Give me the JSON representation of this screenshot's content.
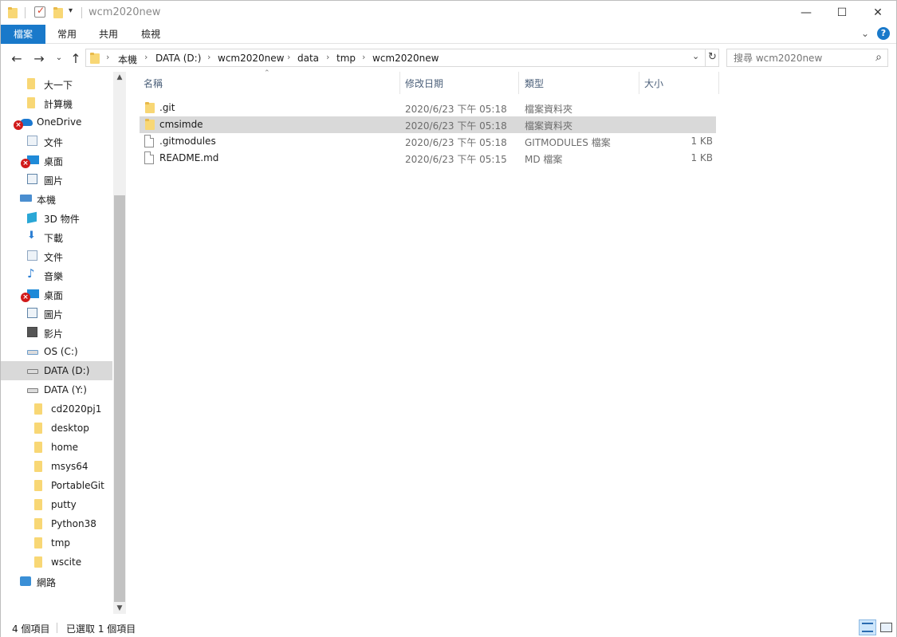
{
  "window": {
    "title": "wcm2020new",
    "controls": {
      "minimize": "—",
      "maximize": "☐",
      "close": "✕"
    }
  },
  "ribbon": {
    "tabs": [
      {
        "label": "檔案",
        "active": true
      },
      {
        "label": "常用"
      },
      {
        "label": "共用"
      },
      {
        "label": "檢視"
      }
    ],
    "help": "?"
  },
  "address": {
    "crumbs": [
      "本機",
      "DATA (D:)",
      "wcm2020new",
      "data",
      "tmp",
      "wcm2020new"
    ],
    "search_placeholder": "搜尋 wcm2020new"
  },
  "nav_pane": {
    "items": [
      {
        "label": "大一下",
        "icon": "folder-icon",
        "indent": 1
      },
      {
        "label": "計算機",
        "icon": "folder-icon",
        "indent": 1
      },
      {
        "label": "OneDrive",
        "icon": "onedrive-cloud-icon",
        "indent": 0,
        "error": true
      },
      {
        "label": "文件",
        "icon": "documents-icon",
        "indent": 1
      },
      {
        "label": "桌面",
        "icon": "desktop-icon",
        "indent": 1,
        "error": true
      },
      {
        "label": "圖片",
        "icon": "pictures-icon",
        "indent": 1
      },
      {
        "label": "本機",
        "icon": "this-pc-icon",
        "indent": 0
      },
      {
        "label": "3D 物件",
        "icon": "3d-objects-icon",
        "indent": 1
      },
      {
        "label": "下載",
        "icon": "downloads-icon",
        "indent": 1
      },
      {
        "label": "文件",
        "icon": "documents-icon",
        "indent": 1
      },
      {
        "label": "音樂",
        "icon": "music-icon",
        "indent": 1
      },
      {
        "label": "桌面",
        "icon": "desktop-icon",
        "indent": 1,
        "error": true
      },
      {
        "label": "圖片",
        "icon": "pictures-icon",
        "indent": 1
      },
      {
        "label": "影片",
        "icon": "videos-icon",
        "indent": 1
      },
      {
        "label": "OS (C:)",
        "icon": "os-drive-icon",
        "indent": 1
      },
      {
        "label": "DATA (D:)",
        "icon": "drive-icon",
        "indent": 1,
        "selected": true
      },
      {
        "label": "DATA (Y:)",
        "icon": "network-drive-icon",
        "indent": 1
      },
      {
        "label": "cd2020pj1",
        "icon": "folder-icon",
        "indent": 2
      },
      {
        "label": "desktop",
        "icon": "folder-icon",
        "indent": 2
      },
      {
        "label": "home",
        "icon": "folder-icon",
        "indent": 2
      },
      {
        "label": "msys64",
        "icon": "folder-icon",
        "indent": 2
      },
      {
        "label": "PortableGit",
        "icon": "folder-icon",
        "indent": 2
      },
      {
        "label": "putty",
        "icon": "folder-icon",
        "indent": 2
      },
      {
        "label": "Python38",
        "icon": "folder-icon",
        "indent": 2
      },
      {
        "label": "tmp",
        "icon": "folder-icon",
        "indent": 2
      },
      {
        "label": "wscite",
        "icon": "folder-icon",
        "indent": 2
      },
      {
        "label": "網路",
        "icon": "network-icon",
        "indent": 0
      }
    ]
  },
  "file_list": {
    "columns": [
      "名稱",
      "修改日期",
      "類型",
      "大小"
    ],
    "rows": [
      {
        "name": ".git",
        "date": "2020/6/23 下午 05:18",
        "type": "檔案資料夾",
        "size": "",
        "icon": "folder-icon"
      },
      {
        "name": "cmsimde",
        "date": "2020/6/23 下午 05:18",
        "type": "檔案資料夾",
        "size": "",
        "icon": "folder-icon",
        "selected": true
      },
      {
        "name": ".gitmodules",
        "date": "2020/6/23 下午 05:18",
        "type": "GITMODULES 檔案",
        "size": "1 KB",
        "icon": "file-icon"
      },
      {
        "name": "README.md",
        "date": "2020/6/23 下午 05:15",
        "type": "MD 檔案",
        "size": "1 KB",
        "icon": "file-icon"
      }
    ]
  },
  "status_bar": {
    "item_count": "4 個項目",
    "selected_count": "已選取 1 個項目"
  },
  "colors": {
    "accent": "#1979ca",
    "folder": "#f8d775",
    "selection": "#d9d9d9",
    "error": "#d11a1a"
  }
}
